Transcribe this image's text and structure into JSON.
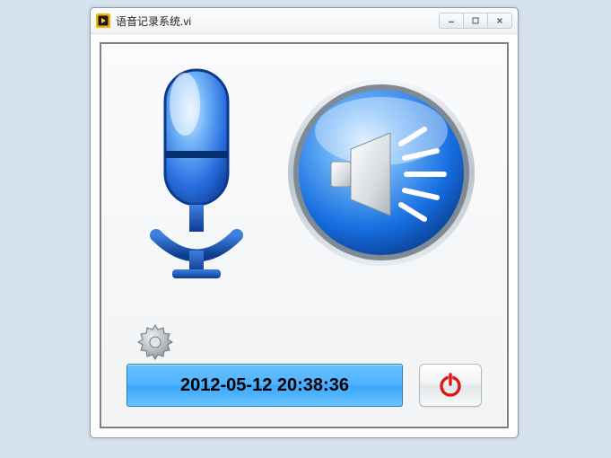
{
  "window": {
    "title": "语音记录系统.vi"
  },
  "icons": {
    "microphone": "microphone-icon",
    "speaker": "speaker-icon",
    "gear": "gear-icon",
    "power": "power-icon"
  },
  "timestamp": "2012-05-12 20:38:36",
  "colors": {
    "accent_blue": "#2f7ee6",
    "timestamp_bg": "#4fb3ff",
    "power_red": "#e31414"
  }
}
